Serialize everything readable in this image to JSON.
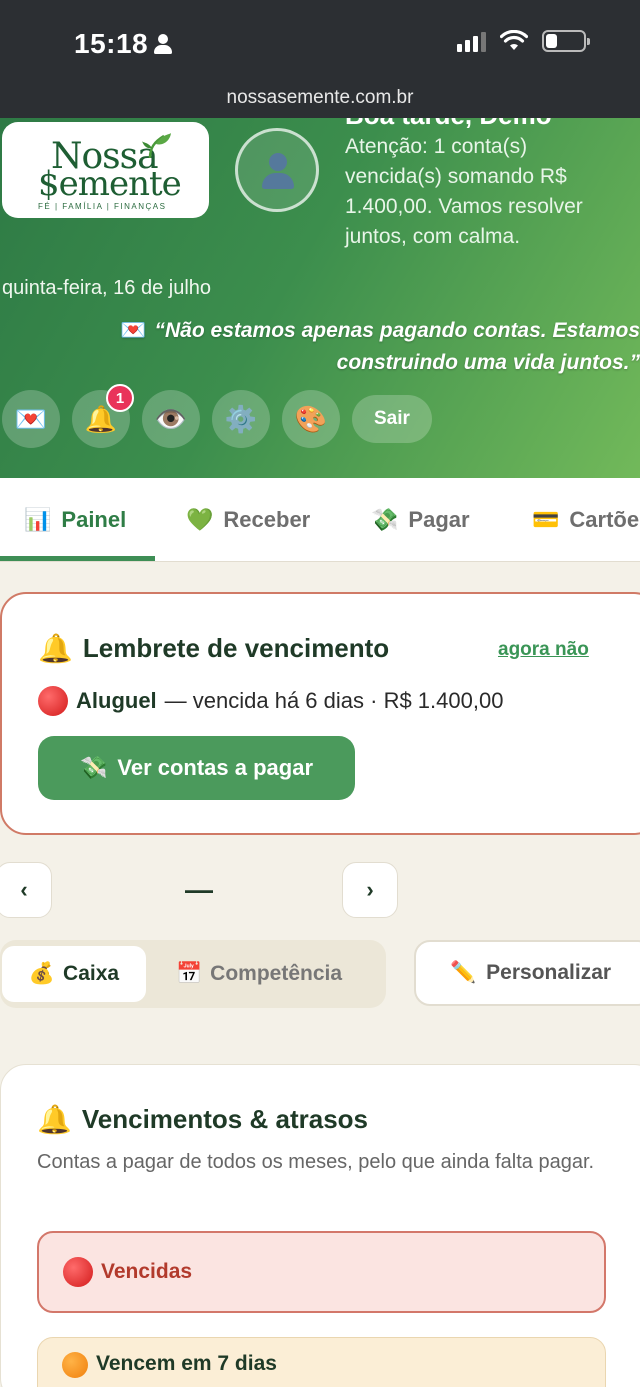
{
  "status_bar": {
    "time": "15:18",
    "battery_level": 0.3
  },
  "url_bar": {
    "url": "nossasemente.com.br"
  },
  "hero": {
    "logo": {
      "line1": "Nossa",
      "line2": "$emente",
      "tagline": "FÉ | FAMÍLIA | FINANÇAS"
    },
    "greeting": "Boa tarde, Demo",
    "alert": "Atenção: 1 conta(s) vencida(s) somando R$ 1.400,00. Vamos resolver juntos, com calma.",
    "date": "quinta-feira, 16 de julho",
    "quote": "“Não estamos apenas pagando contas. Estamos construindo uma vida juntos.”",
    "quote_icon": "💌",
    "buttons": [
      {
        "icon": "💌",
        "name": "love-letter-icon"
      },
      {
        "icon": "🔔",
        "name": "bell-icon",
        "badge": "1"
      },
      {
        "icon": "👁️",
        "name": "eye-icon"
      },
      {
        "icon": "⚙️",
        "name": "gear-icon"
      },
      {
        "icon": "🎨",
        "name": "palette-icon"
      }
    ],
    "logout_label": "Sair"
  },
  "tabs": [
    {
      "icon": "📊",
      "label": "Painel",
      "active": true
    },
    {
      "icon": "💚",
      "label": "Receber"
    },
    {
      "icon": "💸",
      "label": "Pagar"
    },
    {
      "icon": "💳",
      "label": "Cartões"
    }
  ],
  "reminder": {
    "icon": "🔔",
    "title": "Lembrete de vencimento",
    "dismiss": "agora não",
    "item_name": "Aluguel",
    "item_detail": "— vencida há 6 dias · R$ 1.400,00",
    "button_icon": "💸",
    "button_label": "Ver contas a pagar"
  },
  "month_nav": {
    "prev": "‹",
    "next": "›",
    "label": "—"
  },
  "view_toggle": {
    "cash": {
      "icon": "💰",
      "label": "Caixa"
    },
    "accrual": {
      "icon": "📅",
      "label": "Competência"
    },
    "customize": {
      "icon": "✏️",
      "label": "Personalizar"
    }
  },
  "due_section": {
    "icon": "🔔",
    "title": "Vencimentos & atrasos",
    "description": "Contas a pagar de todos os meses, pelo que ainda falta pagar.",
    "overdue_label": "Vencidas",
    "soon_label": "Vencem em 7 dias"
  },
  "colors": {
    "brand_green": "#2e7a45",
    "accent_green": "#4b9a5c",
    "danger": "#d3776a",
    "background": "#f4f1e8"
  }
}
